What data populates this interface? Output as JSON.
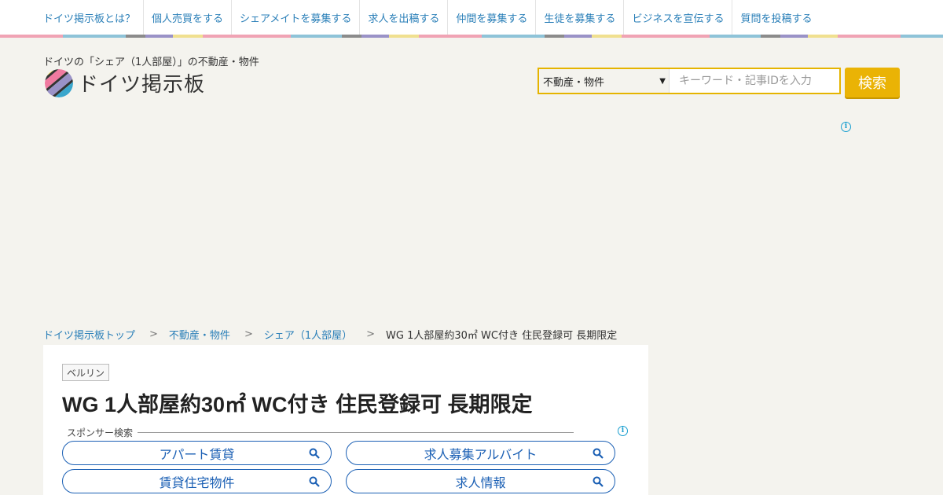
{
  "nav": {
    "items": [
      "ドイツ掲示板とは？",
      "個人売買をする",
      "シェアメイトを募集する",
      "求人を出稿する",
      "仲間を募集する",
      "生徒を募集する",
      "ビジネスを宣伝する",
      "質問を投稿する"
    ]
  },
  "stripe_colors": [
    "#f0a3b4",
    "#8ec3d8",
    "#8b8b8b",
    "#9a92c7",
    "#f0e08f"
  ],
  "header": {
    "tagline": "ドイツの「シェア（1人部屋）」の不動産・物件",
    "logo_text": "ドイツ掲示板"
  },
  "search": {
    "category": "不動産・物件",
    "placeholder": "キーワード・記事IDを入力",
    "button_label": "検索"
  },
  "ad_info_glyph": "i",
  "breadcrumb": {
    "items": [
      "ドイツ掲示板トップ",
      "不動産・物件",
      "シェア（1人部屋）"
    ],
    "separator": ">",
    "current": "WG 1人部屋約30㎡ WC付き 住民登録可 長期限定"
  },
  "post": {
    "city": "ベルリン",
    "title": "WG 1人部屋約30㎡ WC付き 住民登録可 長期限定",
    "sponsor_label": "スポンサー検索",
    "sponsor_links": [
      "アパート賃貸",
      "求人募集アルバイト",
      "賃貸住宅物件",
      "求人情報"
    ]
  },
  "colors": {
    "accent": "#eab305",
    "link": "#2a7fb8",
    "sponsor": "#1a5fb4"
  }
}
